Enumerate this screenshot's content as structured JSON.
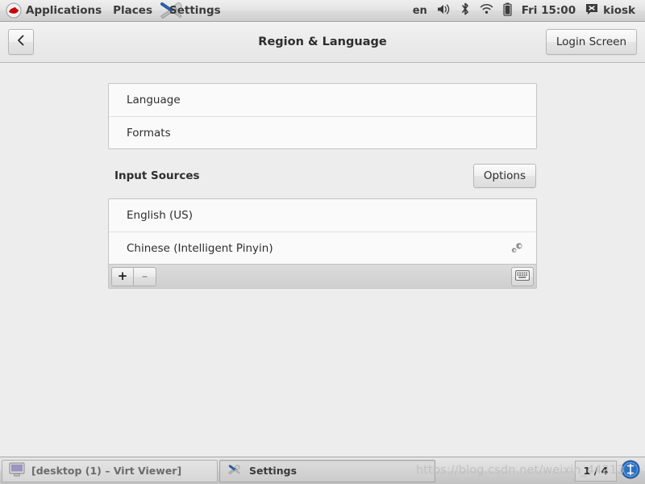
{
  "top_panel": {
    "logo_icon": "redhat-logo-icon",
    "menus": [
      {
        "label": "Applications",
        "icon": "redhat-logo-icon"
      },
      {
        "label": "Places",
        "icon": null
      },
      {
        "label": "Settings",
        "icon": "tools-settings-icon"
      }
    ],
    "status": {
      "keyboard_layout": "en",
      "volume_icon": "volume-icon",
      "bluetooth_icon": "bluetooth-icon",
      "network_icon": "wifi-icon",
      "battery_icon": "battery-icon",
      "clock": "Fri 15:00",
      "message_icon": "message-icon",
      "user": "kiosk"
    }
  },
  "headerbar": {
    "back_icon": "chevron-left-icon",
    "title": "Region & Language",
    "login_screen_label": "Login Screen"
  },
  "content": {
    "region_rows": [
      {
        "label": "Language"
      },
      {
        "label": "Formats"
      }
    ],
    "input_sources": {
      "title": "Input Sources",
      "options_label": "Options",
      "rows": [
        {
          "label": "English (US)",
          "has_gear": false
        },
        {
          "label": "Chinese (Intelligent Pinyin)",
          "has_gear": true,
          "gear_icon": "preferences-gears-icon"
        }
      ],
      "toolbar": {
        "add_label": "+",
        "remove_label": "–",
        "keyboard_icon": "keyboard-icon"
      }
    }
  },
  "taskbar": {
    "tasks": [
      {
        "label": "[desktop (1) – Virt Viewer]",
        "icon": "monitor-icon",
        "active": false
      },
      {
        "label": "Settings",
        "icon": "tools-settings-icon",
        "active": true
      }
    ],
    "workspace_indicator": "1 / 4",
    "show_desktop_icon": "show-desktop-icon"
  },
  "watermark": {
    "text": "https://blog.csdn.net/weixin_44213"
  },
  "colors": {
    "page_background": "#ededed",
    "list_background": "#fafafa",
    "border": "#c5c5c5",
    "text": "#2e2e2e",
    "panel_text": "#3b3b3b"
  }
}
